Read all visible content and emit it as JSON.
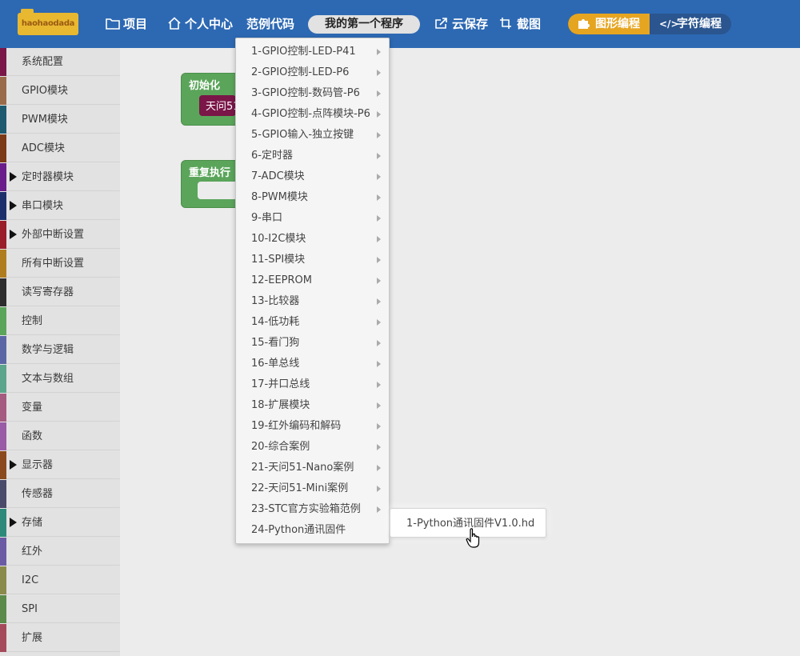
{
  "logo": {
    "text": "haohaodada"
  },
  "nav": {
    "project": "项目",
    "personal": "个人中心",
    "examples": "范例代码",
    "program_name": "我的第一个程序",
    "cloud_save": "云保存",
    "screenshot": "截图",
    "graphic_editor": "图形编程",
    "code_editor": "字符编程"
  },
  "sidebar": {
    "items": [
      {
        "label": "系统配置",
        "color": "#7a1648",
        "expandable": false
      },
      {
        "label": "GPIO模块",
        "color": "#9a6b4a",
        "expandable": false
      },
      {
        "label": "PWM模块",
        "color": "#1d5a70",
        "expandable": false
      },
      {
        "label": "ADC模块",
        "color": "#7b3a17",
        "expandable": false
      },
      {
        "label": "定时器模块",
        "color": "#6a1d8a",
        "expandable": true
      },
      {
        "label": "串口模块",
        "color": "#1d2f6b",
        "expandable": true
      },
      {
        "label": "外部中断设置",
        "color": "#9a1d2a",
        "expandable": true
      },
      {
        "label": "所有中断设置",
        "color": "#b07d1e",
        "expandable": false
      },
      {
        "label": "读写寄存器",
        "color": "#2d2d2d",
        "expandable": false
      },
      {
        "label": "控制",
        "color": "#5ba55b",
        "expandable": false
      },
      {
        "label": "数学与逻辑",
        "color": "#5b67a5",
        "expandable": false
      },
      {
        "label": "文本与数组",
        "color": "#5ba58c",
        "expandable": false
      },
      {
        "label": "变量",
        "color": "#a55b80",
        "expandable": false
      },
      {
        "label": "函数",
        "color": "#995ba5",
        "expandable": false
      },
      {
        "label": "显示器",
        "color": "#8a4a1d",
        "expandable": true
      },
      {
        "label": "传感器",
        "color": "#4a4a6b",
        "expandable": false
      },
      {
        "label": "存储",
        "color": "#2d8a7a",
        "expandable": true
      },
      {
        "label": "红外",
        "color": "#6b5ba5",
        "expandable": false
      },
      {
        "label": "I2C",
        "color": "#8a8a4a",
        "expandable": false
      },
      {
        "label": "SPI",
        "color": "#5b8a4a",
        "expandable": false
      },
      {
        "label": "扩展",
        "color": "#a54a5b",
        "expandable": false
      }
    ]
  },
  "workspace": {
    "init_block": "初始化",
    "init_inner": "天问51",
    "loop_block": "重复执行"
  },
  "menu": {
    "items": [
      "1-GPIO控制-LED-P41",
      "2-GPIO控制-LED-P6",
      "3-GPIO控制-数码管-P6",
      "4-GPIO控制-点阵模块-P6",
      "5-GPIO输入-独立按键",
      "6-定时器",
      "7-ADC模块",
      "8-PWM模块",
      "9-串口",
      "10-I2C模块",
      "11-SPI模块",
      "12-EEPROM",
      "13-比较器",
      "14-低功耗",
      "15-看门狗",
      "16-单总线",
      "17-并口总线",
      "18-扩展模块",
      "19-红外编码和解码",
      "20-综合案例",
      "21-天问51-Nano案例",
      "22-天问51-Mini案例",
      "23-STC官方实验箱范例",
      "24-Python通讯固件"
    ]
  },
  "submenu": {
    "items": [
      "1-Python通讯固件V1.0.hd"
    ]
  }
}
